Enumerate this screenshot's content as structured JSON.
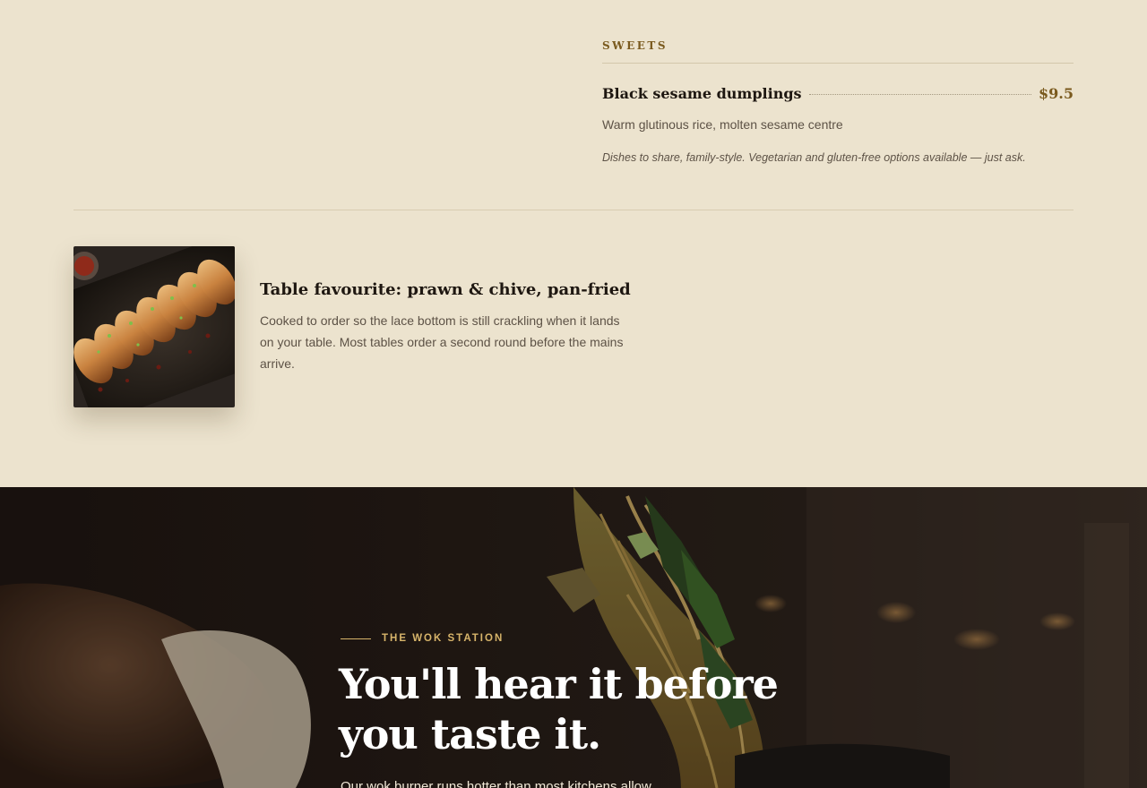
{
  "sweets": {
    "title": "SWEETS",
    "item": {
      "name": "Black sesame dumplings",
      "price": "$9.5",
      "description": "Warm glutinous rice, molten sesame centre"
    },
    "note": "Dishes to share, family-style. Vegetarian and gluten-free options available — just ask."
  },
  "feature": {
    "title": "Table favourite: prawn & chive, pan-fried",
    "body": "Cooked to order so the lace bottom is still crackling when it lands on your table. Most tables order a second round before the mains arrive."
  },
  "wok": {
    "eyebrow": "THE WOK STATION",
    "title": "You'll hear it before you taste it.",
    "body": "Our wok burner runs hotter than most kitchens allow."
  },
  "colors": {
    "page_bg": "#ece3ce",
    "accent_brown": "#7a5a1e",
    "accent_gold": "#d7b46a",
    "text_dark": "#1e1711",
    "text_muted": "#5d5246"
  }
}
